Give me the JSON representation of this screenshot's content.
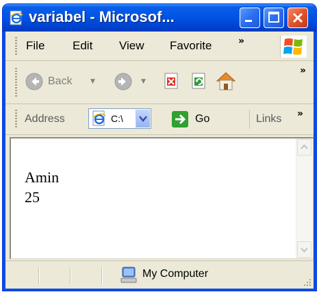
{
  "window": {
    "title": "variabel - Microsof..."
  },
  "menu": {
    "items": [
      "File",
      "Edit",
      "View",
      "Favorite"
    ],
    "overflow": "»"
  },
  "toolbar": {
    "back_label": "Back",
    "overflow": "»"
  },
  "address": {
    "label": "Address",
    "value": "C:\\",
    "go_label": "Go",
    "links_label": "Links",
    "overflow": "»"
  },
  "content": {
    "lines": [
      "Amin",
      "25"
    ]
  },
  "status": {
    "zone": "My Computer"
  },
  "colors": {
    "title_bar": "#0055e5",
    "chrome": "#ece9d8",
    "close_button": "#e2542c",
    "go_arrow": "#2fa12f"
  },
  "icons": [
    "ie-page-icon",
    "minimize-icon",
    "maximize-icon",
    "close-icon",
    "windows-logo-icon",
    "back-icon",
    "forward-icon",
    "stop-icon",
    "refresh-icon",
    "home-icon",
    "go-arrow-icon",
    "my-computer-icon"
  ]
}
